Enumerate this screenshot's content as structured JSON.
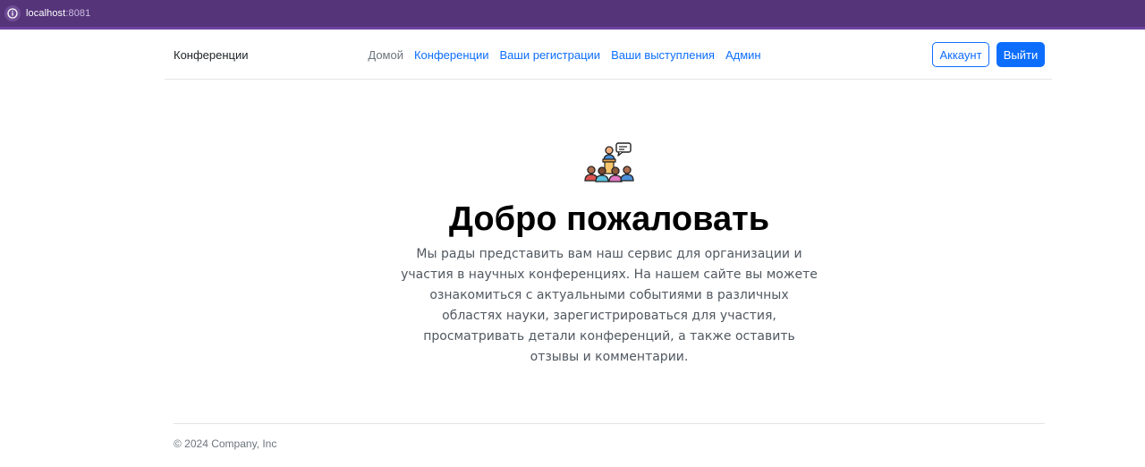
{
  "browser": {
    "host": "localhost",
    "port": ":8081"
  },
  "navbar": {
    "brand": "Конференции",
    "links": [
      {
        "label": "Домой"
      },
      {
        "label": "Конференции"
      },
      {
        "label": "Ваши регистрации"
      },
      {
        "label": "Ваши выступления"
      },
      {
        "label": "Админ"
      }
    ],
    "account_label": "Аккаунт",
    "logout_label": "Выйти"
  },
  "hero": {
    "icon": "conference-speaker-icon",
    "title": "Добро пожаловать",
    "text": "Мы рады представить вам наш сервис для организации и участия в научных конференциях. На нашем сайте вы можете ознакомиться с актуальными событиями в различных областях науки, зарегистрироваться для участия, просматривать детали конференций, а также оставить отзывы и комментарии."
  },
  "footer": {
    "copyright": "© 2024 Company, Inc"
  },
  "colors": {
    "address_bar": "#55347a",
    "primary": "#0d6efd",
    "muted": "#6c757d"
  }
}
